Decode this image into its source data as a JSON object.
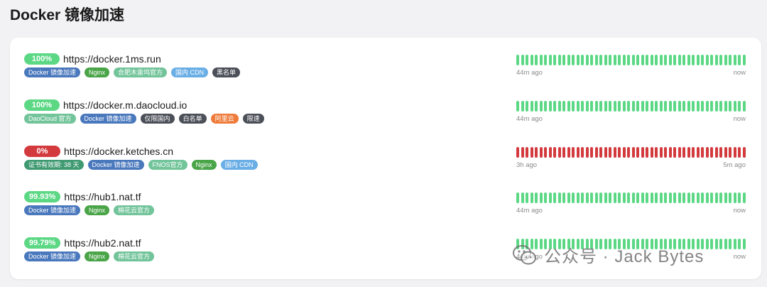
{
  "header": {
    "title": "Docker 镜像加速"
  },
  "colors": {
    "up": "#5cd885",
    "down": "#d33a3e",
    "tag_blue": "#4a78bd",
    "tag_green": "#4aa548",
    "tag_mint": "#72c49a",
    "tag_lightblue": "#6aaee6",
    "tag_dark": "#4b4f58",
    "tag_orange": "#ee7b3a",
    "tag_teal": "#3f9a72"
  },
  "monitors": [
    {
      "uptime": "100%",
      "status": "up",
      "url": "https://docker.1ms.run",
      "tags": [
        {
          "label": "Docker 镜像加速",
          "color": "blue"
        },
        {
          "label": "Nginx",
          "color": "green"
        },
        {
          "label": "合肥木雷坞官方",
          "color": "mint"
        },
        {
          "label": "国内 CDN",
          "color": "lightblue"
        },
        {
          "label": "黑名单",
          "color": "dark"
        }
      ],
      "beats": 50,
      "time_start": "44m ago",
      "time_end": "now"
    },
    {
      "uptime": "100%",
      "status": "up",
      "url": "https://docker.m.daocloud.io",
      "tags": [
        {
          "label": "DaoCloud 官方",
          "color": "mint"
        },
        {
          "label": "Docker 镜像加速",
          "color": "blue"
        },
        {
          "label": "仅限国内",
          "color": "dark"
        },
        {
          "label": "白名单",
          "color": "dark"
        },
        {
          "label": "阿里云",
          "color": "orange"
        },
        {
          "label": "限速",
          "color": "dark"
        }
      ],
      "beats": 50,
      "time_start": "44m ago",
      "time_end": "now"
    },
    {
      "uptime": "0%",
      "status": "down",
      "url": "https://docker.ketches.cn",
      "tags": [
        {
          "label": "证书有效期: 38 天",
          "color": "teal"
        },
        {
          "label": "Docker 镜像加速",
          "color": "blue"
        },
        {
          "label": "FNOS官方",
          "color": "mint"
        },
        {
          "label": "Nginx",
          "color": "green"
        },
        {
          "label": "国内 CDN",
          "color": "lightblue"
        }
      ],
      "beats": 50,
      "time_start": "3h ago",
      "time_end": "5m ago"
    },
    {
      "uptime": "99.93%",
      "status": "up",
      "url": "https://hub1.nat.tf",
      "tags": [
        {
          "label": "Docker 镜像加速",
          "color": "blue"
        },
        {
          "label": "Nginx",
          "color": "green"
        },
        {
          "label": "棉花云官方",
          "color": "mint"
        }
      ],
      "beats": 50,
      "time_start": "44m ago",
      "time_end": "now"
    },
    {
      "uptime": "99.79%",
      "status": "up",
      "url": "https://hub2.nat.tf",
      "tags": [
        {
          "label": "Docker 镜像加速",
          "color": "blue"
        },
        {
          "label": "Nginx",
          "color": "green"
        },
        {
          "label": "棉花云官方",
          "color": "mint"
        }
      ],
      "beats": 50,
      "time_start": "44m ago",
      "time_end": "now"
    }
  ],
  "watermark": {
    "text": "公众号 · Jack Bytes",
    "icon": "wechat-icon"
  }
}
